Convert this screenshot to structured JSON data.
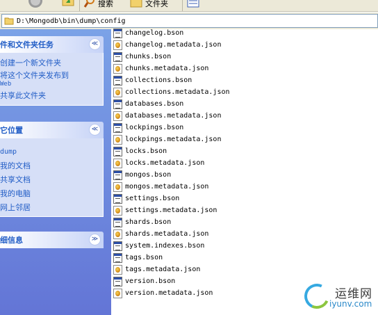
{
  "toolbar": {
    "search_label": "搜索",
    "folders_label": "文件夹"
  },
  "address": {
    "path": "D:\\Mongodb\\bin\\dump\\config"
  },
  "taskpane": {
    "file_tasks": {
      "title": "件和文件夹任务",
      "toggle": "≪",
      "links": [
        "创建一个新文件夹",
        "将这个文件夹发布到",
        "共享此文件夹"
      ],
      "web_suffix": "Web"
    },
    "other_places": {
      "title": "它位置",
      "toggle": "≪",
      "links": [
        "dump",
        "我的文档",
        "共享文档",
        "我的电脑",
        "网上邻居"
      ]
    },
    "details": {
      "title": "细信息",
      "toggle": "≫"
    }
  },
  "files": [
    {
      "name": "changelog.bson",
      "type": "bson"
    },
    {
      "name": "changelog.metadata.json",
      "type": "json"
    },
    {
      "name": "chunks.bson",
      "type": "bson"
    },
    {
      "name": "chunks.metadata.json",
      "type": "json"
    },
    {
      "name": "collections.bson",
      "type": "bson"
    },
    {
      "name": "collections.metadata.json",
      "type": "json"
    },
    {
      "name": "databases.bson",
      "type": "bson"
    },
    {
      "name": "databases.metadata.json",
      "type": "json"
    },
    {
      "name": "lockpings.bson",
      "type": "bson"
    },
    {
      "name": "lockpings.metadata.json",
      "type": "json"
    },
    {
      "name": "locks.bson",
      "type": "bson"
    },
    {
      "name": "locks.metadata.json",
      "type": "json"
    },
    {
      "name": "mongos.bson",
      "type": "bson"
    },
    {
      "name": "mongos.metadata.json",
      "type": "json"
    },
    {
      "name": "settings.bson",
      "type": "bson"
    },
    {
      "name": "settings.metadata.json",
      "type": "json"
    },
    {
      "name": "shards.bson",
      "type": "bson"
    },
    {
      "name": "shards.metadata.json",
      "type": "json"
    },
    {
      "name": "system.indexes.bson",
      "type": "bson"
    },
    {
      "name": "tags.bson",
      "type": "bson"
    },
    {
      "name": "tags.metadata.json",
      "type": "json"
    },
    {
      "name": "version.bson",
      "type": "bson"
    },
    {
      "name": "version.metadata.json",
      "type": "json"
    }
  ],
  "icons": {
    "bson": "bson-file-icon",
    "json": "json-file-icon",
    "folder": "folder-icon"
  },
  "watermark": {
    "cn": "运维网",
    "url": "iyunv.com"
  },
  "colors": {
    "task_link": "#215dc6",
    "pane_top": "#7ba2e7",
    "pane_bottom": "#6375d6"
  }
}
